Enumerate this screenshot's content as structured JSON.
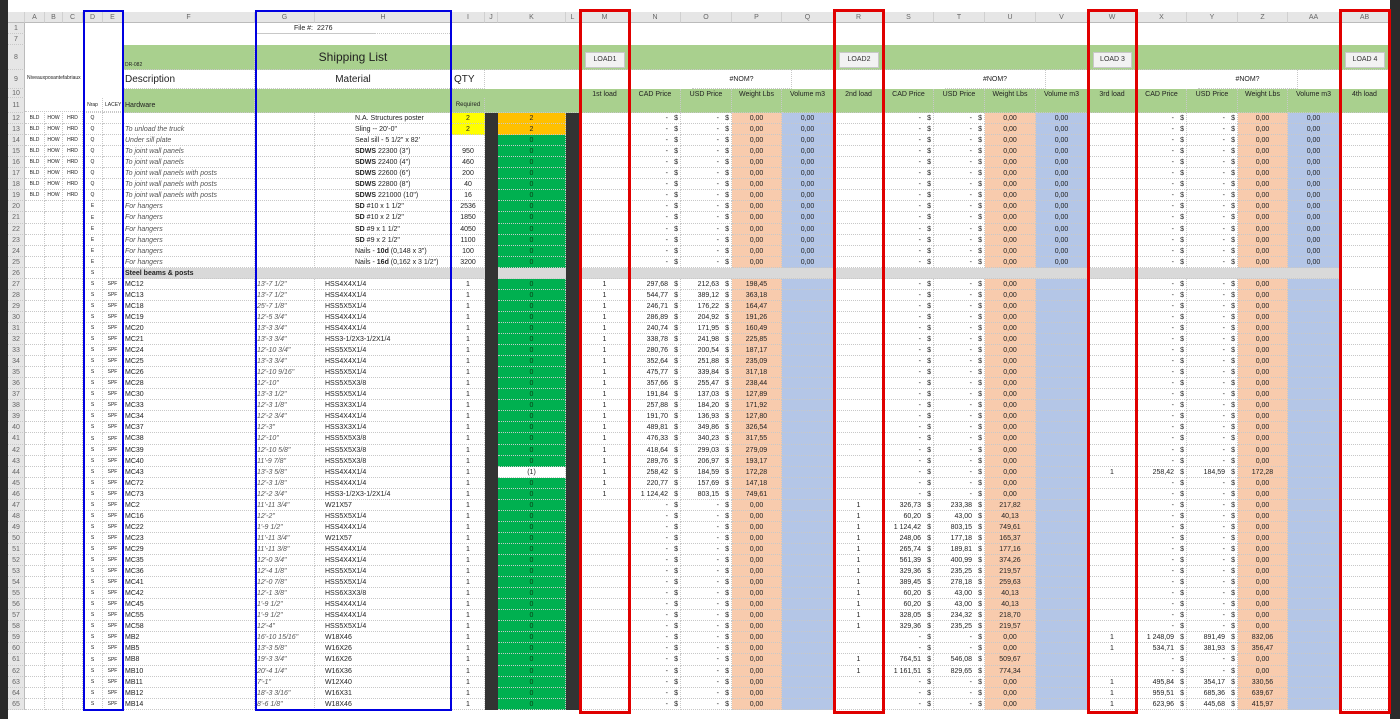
{
  "column_letters": [
    "A",
    "B",
    "C",
    "D",
    "E",
    "F",
    "G",
    "H",
    "I",
    "J",
    "K",
    "L",
    "M",
    "N",
    "O",
    "P",
    "Q",
    "R",
    "S",
    "T",
    "U",
    "V",
    "W",
    "X",
    "Y",
    "Z",
    "AA",
    "AB"
  ],
  "header": {
    "file_label": "File #:",
    "file_number": "2276",
    "doc_code": "DR-082",
    "title": "Shipping List",
    "description_label": "Description",
    "material_label": "Material",
    "qty_label": "QTY",
    "section_label": "Hardware",
    "required_label": "Required",
    "side_label": "Niveauxposantefabriaux",
    "d_label": "Nrap",
    "e_label": "LACEY",
    "error_value": "#NOM?",
    "loads": [
      {
        "button": "LOAD1",
        "qty_label": "1st load"
      },
      {
        "button": "LOAD2",
        "qty_label": "2nd load"
      },
      {
        "button": "LOAD 3",
        "qty_label": "3rd load"
      },
      {
        "button": "LOAD 4",
        "qty_label": "4th load"
      }
    ],
    "cad_label": "CAD Price",
    "usd_label": "USD Price",
    "weight_label": "Weight Lbs",
    "volume_label": "Volume m3"
  },
  "currency": "$",
  "empty_load": [
    "",
    "-",
    "-",
    "0,00"
  ],
  "colors": {
    "header_green": "#a9d08e",
    "required_green": "#00b050",
    "qty_orange": "#ffc000",
    "qty_yellow": "#ffff00",
    "weight": "#f8cbad",
    "volume": "#b4c6e7",
    "highlight_red": "#e00000",
    "highlight_blue": "#0000e0"
  },
  "rows": [
    {
      "r": "12",
      "A": "BLD",
      "B": "HOW",
      "C": "HRD",
      "D": "Q",
      "F": "",
      "H": [
        "",
        "",
        "N.A. Structures poster"
      ],
      "I": "2",
      "Ic": "yellow",
      "K": "2",
      "Kc": "orange",
      "vol": "0,00"
    },
    {
      "r": "13",
      "A": "BLD",
      "B": "HOW",
      "C": "HRD",
      "D": "Q",
      "F": "To unload the truck",
      "H": [
        "",
        "",
        "Sling -- 20'-0\""
      ],
      "I": "2",
      "Ic": "yellow",
      "K": "2",
      "Kc": "orange",
      "vol": "0,00"
    },
    {
      "r": "14",
      "A": "BLD",
      "B": "HOW",
      "C": "HRD",
      "D": "Q",
      "F": "Under sill plate",
      "H": [
        "",
        "",
        "Seal sill - 5 1/2\" x 82'"
      ],
      "I": "",
      "K": "0",
      "vol": "0,00"
    },
    {
      "r": "15",
      "A": "BLD",
      "B": "HOW",
      "C": "HRD",
      "D": "Q",
      "F": "To joint wall panels",
      "H": [
        "",
        "SDWS",
        " 22300 (3\")"
      ],
      "I": "950",
      "K": "0",
      "vol": "0,00"
    },
    {
      "r": "16",
      "A": "BLD",
      "B": "HOW",
      "C": "HRD",
      "D": "Q",
      "F": "To joint wall panels",
      "H": [
        "",
        "SDWS",
        " 22400 (4\")"
      ],
      "I": "460",
      "K": "0",
      "vol": "0,00"
    },
    {
      "r": "17",
      "A": "BLD",
      "B": "HOW",
      "C": "HRD",
      "D": "Q",
      "F": "To joint wall panels with posts",
      "H": [
        "",
        "SDWS",
        " 22600 (6\")"
      ],
      "I": "200",
      "K": "0",
      "vol": "0,00"
    },
    {
      "r": "18",
      "A": "BLD",
      "B": "HOW",
      "C": "HRD",
      "D": "Q",
      "F": "To joint wall panels with posts",
      "H": [
        "",
        "SDWS",
        " 22800 (8\")"
      ],
      "I": "40",
      "K": "0",
      "vol": "0,00"
    },
    {
      "r": "19",
      "A": "BLD",
      "B": "HOW",
      "C": "HRD",
      "D": "Q",
      "F": "To joint wall panels with posts",
      "H": [
        "",
        "SDWS",
        " 221000 (10\")"
      ],
      "I": "16",
      "K": "0",
      "vol": "0,00"
    },
    {
      "r": "20",
      "D": "E",
      "F": "For hangers",
      "H": [
        "",
        "SD",
        " #10 x 1 1/2\""
      ],
      "I": "2536",
      "K": "0",
      "vol": "0,00"
    },
    {
      "r": "21",
      "D": "E",
      "F": "For hangers",
      "H": [
        "",
        "SD",
        " #10 x 2 1/2\""
      ],
      "I": "1850",
      "K": "0",
      "vol": "0,00"
    },
    {
      "r": "22",
      "D": "E",
      "F": "For hangers",
      "H": [
        "",
        "SD",
        " #9 x 1 1/2\""
      ],
      "I": "4050",
      "K": "0",
      "vol": "0,00"
    },
    {
      "r": "23",
      "D": "E",
      "F": "For hangers",
      "H": [
        "",
        "SD",
        " #9 x 2 1/2\""
      ],
      "I": "1100",
      "K": "0",
      "vol": "0,00"
    },
    {
      "r": "24",
      "D": "E",
      "F": "For hangers",
      "H": [
        "Nails - ",
        "10d",
        " (0,148 x 3\")"
      ],
      "I": "100",
      "K": "0",
      "vol": "0,00"
    },
    {
      "r": "25",
      "D": "E",
      "F": "For hangers",
      "H": [
        "Nails - ",
        "16d",
        " (0,162 x 3 1/2\")"
      ],
      "I": "3200",
      "K": "0",
      "vol": "0,00"
    },
    {
      "r": "26",
      "D": "S",
      "F": "Steel beams & posts",
      "section": true
    },
    {
      "r": "27",
      "D": "S",
      "E": "SPF",
      "F": "MC12",
      "G": "13'-7 1/2\"",
      "H": [
        "",
        "",
        "HSS4X4X1/4"
      ],
      "I": "1",
      "K": "0",
      "loads": [
        [
          "1",
          "297,68",
          "212,63",
          "198,45"
        ],
        null,
        null
      ]
    },
    {
      "r": "28",
      "D": "S",
      "E": "SPF",
      "F": "MC13",
      "G": "13'-7 1/2\"",
      "H": [
        "",
        "",
        "HSS4X4X1/4"
      ],
      "I": "1",
      "K": "0",
      "loads": [
        [
          "1",
          "544,77",
          "389,12",
          "363,18"
        ],
        null,
        null
      ]
    },
    {
      "r": "29",
      "D": "S",
      "E": "SPF",
      "F": "MC18",
      "G": "25'-7 1/8\"",
      "H": [
        "",
        "",
        "HSS5X5X1/4"
      ],
      "I": "1",
      "K": "0",
      "loads": [
        [
          "1",
          "246,71",
          "176,22",
          "164,47"
        ],
        null,
        null
      ]
    },
    {
      "r": "30",
      "D": "S",
      "E": "SPF",
      "F": "MC19",
      "G": "12'-5 3/4\"",
      "H": [
        "",
        "",
        "HSS4X4X1/4"
      ],
      "I": "1",
      "K": "0",
      "loads": [
        [
          "1",
          "286,89",
          "204,92",
          "191,26"
        ],
        null,
        null
      ]
    },
    {
      "r": "31",
      "D": "S",
      "E": "SPF",
      "F": "MC20",
      "G": "13'-3 3/4\"",
      "H": [
        "",
        "",
        "HSS4X4X1/4"
      ],
      "I": "1",
      "K": "0",
      "loads": [
        [
          "1",
          "240,74",
          "171,95",
          "160,49"
        ],
        null,
        null
      ]
    },
    {
      "r": "32",
      "D": "S",
      "E": "SPF",
      "F": "MC21",
      "G": "13'-3 3/4\"",
      "H": [
        "",
        "",
        "HSS3-1/2X3-1/2X1/4"
      ],
      "I": "1",
      "K": "0",
      "loads": [
        [
          "1",
          "338,78",
          "241,98",
          "225,85"
        ],
        null,
        null
      ]
    },
    {
      "r": "33",
      "D": "S",
      "E": "SPF",
      "F": "MC24",
      "G": "12'-10 3/4\"",
      "H": [
        "",
        "",
        "HSS5X5X1/4"
      ],
      "I": "1",
      "K": "0",
      "loads": [
        [
          "1",
          "280,76",
          "200,54",
          "187,17"
        ],
        null,
        null
      ]
    },
    {
      "r": "34",
      "D": "S",
      "E": "SPF",
      "F": "MC25",
      "G": "13'-3 3/4\"",
      "H": [
        "",
        "",
        "HSS4X4X1/4"
      ],
      "I": "1",
      "K": "0",
      "loads": [
        [
          "1",
          "352,64",
          "251,88",
          "235,09"
        ],
        null,
        null
      ]
    },
    {
      "r": "35",
      "D": "S",
      "E": "SPF",
      "F": "MC26",
      "G": "12'-10 9/16\"",
      "H": [
        "",
        "",
        "HSS5X5X1/4"
      ],
      "I": "1",
      "K": "0",
      "loads": [
        [
          "1",
          "475,77",
          "339,84",
          "317,18"
        ],
        null,
        null
      ]
    },
    {
      "r": "36",
      "D": "S",
      "E": "SPF",
      "F": "MC28",
      "G": "12'-10\"",
      "H": [
        "",
        "",
        "HSS5X5X3/8"
      ],
      "I": "1",
      "K": "0",
      "loads": [
        [
          "1",
          "357,66",
          "255,47",
          "238,44"
        ],
        null,
        null
      ]
    },
    {
      "r": "37",
      "D": "S",
      "E": "SPF",
      "F": "MC30",
      "G": "13'-3 1/2\"",
      "H": [
        "",
        "",
        "HSS5X5X1/4"
      ],
      "I": "1",
      "K": "0",
      "loads": [
        [
          "1",
          "191,84",
          "137,03",
          "127,89"
        ],
        null,
        null
      ]
    },
    {
      "r": "38",
      "D": "S",
      "E": "SPF",
      "F": "MC33",
      "G": "12'-3 1/8\"",
      "H": [
        "",
        "",
        "HSS3X3X1/4"
      ],
      "I": "1",
      "K": "0",
      "loads": [
        [
          "1",
          "257,88",
          "184,20",
          "171,92"
        ],
        null,
        null
      ]
    },
    {
      "r": "39",
      "D": "S",
      "E": "SPF",
      "F": "MC34",
      "G": "12'-2 3/4\"",
      "H": [
        "",
        "",
        "HSS4X4X1/4"
      ],
      "I": "1",
      "K": "0",
      "loads": [
        [
          "1",
          "191,70",
          "136,93",
          "127,80"
        ],
        null,
        null
      ]
    },
    {
      "r": "40",
      "D": "S",
      "E": "SPF",
      "F": "MC37",
      "G": "12'-3\"",
      "H": [
        "",
        "",
        "HSS3X3X1/4"
      ],
      "I": "1",
      "K": "0",
      "loads": [
        [
          "1",
          "489,81",
          "349,86",
          "326,54"
        ],
        null,
        null
      ]
    },
    {
      "r": "41",
      "D": "S",
      "E": "SPF",
      "F": "MC38",
      "G": "12'-10\"",
      "H": [
        "",
        "",
        "HSS5X5X3/8"
      ],
      "I": "1",
      "K": "0",
      "loads": [
        [
          "1",
          "476,33",
          "340,23",
          "317,55"
        ],
        null,
        null
      ]
    },
    {
      "r": "42",
      "D": "S",
      "E": "SPF",
      "F": "MC39",
      "G": "12'-10 5/8\"",
      "H": [
        "",
        "",
        "HSS5X5X3/8"
      ],
      "I": "1",
      "K": "0",
      "loads": [
        [
          "1",
          "418,64",
          "299,03",
          "279,09"
        ],
        null,
        null
      ]
    },
    {
      "r": "43",
      "D": "S",
      "E": "SPF",
      "F": "MC40",
      "G": "11'-9 7/8\"",
      "H": [
        "",
        "",
        "HSS5X5X3/8"
      ],
      "I": "1",
      "K": "0",
      "loads": [
        [
          "1",
          "289,76",
          "206,97",
          "193,17"
        ],
        null,
        null
      ]
    },
    {
      "r": "44",
      "D": "S",
      "E": "SPF",
      "F": "MC43",
      "G": "13'-3 5/8\"",
      "H": [
        "",
        "",
        "HSS4X4X1/4"
      ],
      "I": "1",
      "K": "(1)",
      "Kc": "white",
      "loads": [
        [
          "1",
          "258,42",
          "184,59",
          "172,28"
        ],
        null,
        [
          "1",
          "258,42",
          "184,59",
          "172,28"
        ]
      ]
    },
    {
      "r": "45",
      "D": "S",
      "E": "SPF",
      "F": "MC72",
      "G": "12'-3 1/8\"",
      "H": [
        "",
        "",
        "HSS4X4X1/4"
      ],
      "I": "1",
      "K": "0",
      "loads": [
        [
          "1",
          "220,77",
          "157,69",
          "147,18"
        ],
        null,
        null
      ]
    },
    {
      "r": "46",
      "D": "S",
      "E": "SPF",
      "F": "MC73",
      "G": "12'-2 3/4\"",
      "H": [
        "",
        "",
        "HSS3-1/2X3-1/2X1/4"
      ],
      "I": "1",
      "K": "0",
      "loads": [
        [
          "1",
          "1 124,42",
          "803,15",
          "749,61"
        ],
        null,
        null
      ]
    },
    {
      "r": "47",
      "D": "S",
      "E": "SPF",
      "F": "MC2",
      "G": "11'-11 3/4\"",
      "H": [
        "",
        "",
        "W21X57"
      ],
      "I": "1",
      "K": "0",
      "loads": [
        null,
        [
          "1",
          "326,73",
          "233,38",
          "217,82"
        ],
        null
      ]
    },
    {
      "r": "48",
      "D": "S",
      "E": "SPF",
      "F": "MC16",
      "G": "12'-2\"",
      "H": [
        "",
        "",
        "HSS5X5X1/4"
      ],
      "I": "1",
      "K": "0",
      "loads": [
        null,
        [
          "1",
          "60,20",
          "43,00",
          "40,13"
        ],
        null
      ]
    },
    {
      "r": "49",
      "D": "S",
      "E": "SPF",
      "F": "MC22",
      "G": "1'-9 1/2\"",
      "H": [
        "",
        "",
        "HSS4X4X1/4"
      ],
      "I": "1",
      "K": "0",
      "loads": [
        null,
        [
          "1",
          "1 124,42",
          "803,15",
          "749,61"
        ],
        null
      ]
    },
    {
      "r": "50",
      "D": "S",
      "E": "SPF",
      "F": "MC23",
      "G": "11'-11 3/4\"",
      "H": [
        "",
        "",
        "W21X57"
      ],
      "I": "1",
      "K": "0",
      "loads": [
        null,
        [
          "1",
          "248,06",
          "177,18",
          "165,37"
        ],
        null
      ]
    },
    {
      "r": "51",
      "D": "S",
      "E": "SPF",
      "F": "MC29",
      "G": "11'-11 3/8\"",
      "H": [
        "",
        "",
        "HSS4X4X1/4"
      ],
      "I": "1",
      "K": "0",
      "loads": [
        null,
        [
          "1",
          "265,74",
          "189,81",
          "177,16"
        ],
        null
      ]
    },
    {
      "r": "52",
      "D": "S",
      "E": "SPF",
      "F": "MC35",
      "G": "12'-0 3/4\"",
      "H": [
        "",
        "",
        "HSS4X4X1/4"
      ],
      "I": "1",
      "K": "0",
      "loads": [
        null,
        [
          "1",
          "561,39",
          "400,99",
          "374,26"
        ],
        null
      ]
    },
    {
      "r": "53",
      "D": "S",
      "E": "SPF",
      "F": "MC36",
      "G": "12'-4 1/8\"",
      "H": [
        "",
        "",
        "HSS5X5X1/4"
      ],
      "I": "1",
      "K": "0",
      "loads": [
        null,
        [
          "1",
          "329,36",
          "235,25",
          "219,57"
        ],
        null
      ]
    },
    {
      "r": "54",
      "D": "S",
      "E": "SPF",
      "F": "MC41",
      "G": "12'-0 7/8\"",
      "H": [
        "",
        "",
        "HSS5X5X1/4"
      ],
      "I": "1",
      "K": "0",
      "loads": [
        null,
        [
          "1",
          "389,45",
          "278,18",
          "259,63"
        ],
        null
      ]
    },
    {
      "r": "55",
      "D": "S",
      "E": "SPF",
      "F": "MC42",
      "G": "12'-1 3/8\"",
      "H": [
        "",
        "",
        "HSS6X3X3/8"
      ],
      "I": "1",
      "K": "0",
      "loads": [
        null,
        [
          "1",
          "60,20",
          "43,00",
          "40,13"
        ],
        null
      ]
    },
    {
      "r": "56",
      "D": "S",
      "E": "SPF",
      "F": "MC45",
      "G": "1'-9 1/2\"",
      "H": [
        "",
        "",
        "HSS4X4X1/4"
      ],
      "I": "1",
      "K": "0",
      "loads": [
        null,
        [
          "1",
          "60,20",
          "43,00",
          "40,13"
        ],
        null
      ]
    },
    {
      "r": "57",
      "D": "S",
      "E": "SPF",
      "F": "MC55",
      "G": "1'-9 1/2\"",
      "H": [
        "",
        "",
        "HSS4X4X1/4"
      ],
      "I": "1",
      "K": "0",
      "loads": [
        null,
        [
          "1",
          "328,05",
          "234,32",
          "218,70"
        ],
        null
      ]
    },
    {
      "r": "58",
      "D": "S",
      "E": "SPF",
      "F": "MC58",
      "G": "12'-4\"",
      "H": [
        "",
        "",
        "HSS5X5X1/4"
      ],
      "I": "1",
      "K": "0",
      "loads": [
        null,
        [
          "1",
          "329,36",
          "235,25",
          "219,57"
        ],
        null
      ]
    },
    {
      "r": "59",
      "D": "S",
      "E": "SPF",
      "F": "MB2",
      "G": "16'-10 15/16\"",
      "H": [
        "",
        "",
        "W18X46"
      ],
      "I": "1",
      "K": "0",
      "loads": [
        null,
        null,
        [
          "1",
          "1 248,09",
          "891,49",
          "832,06"
        ]
      ]
    },
    {
      "r": "60",
      "D": "S",
      "E": "SPF",
      "F": "MB5",
      "G": "13'-3 5/8\"",
      "H": [
        "",
        "",
        "W16X26"
      ],
      "I": "1",
      "K": "0",
      "loads": [
        null,
        null,
        [
          "1",
          "534,71",
          "381,93",
          "356,47"
        ]
      ]
    },
    {
      "r": "61",
      "D": "S",
      "E": "SPF",
      "F": "MB8",
      "G": "19'-3 3/4\"",
      "H": [
        "",
        "",
        "W16X26"
      ],
      "I": "1",
      "K": "0",
      "loads": [
        null,
        [
          "1",
          "764,51",
          "546,08",
          "509,67"
        ],
        null
      ]
    },
    {
      "r": "62",
      "D": "S",
      "E": "SPF",
      "F": "MB10",
      "G": "20'-4 1/4\"",
      "H": [
        "",
        "",
        "W16X36"
      ],
      "I": "1",
      "K": "0",
      "loads": [
        null,
        [
          "1",
          "1 161,51",
          "829,65",
          "774,34"
        ],
        null
      ]
    },
    {
      "r": "63",
      "D": "S",
      "E": "SPF",
      "F": "MB11",
      "G": "7'-1\"",
      "H": [
        "",
        "",
        "W12X40"
      ],
      "I": "1",
      "K": "0",
      "loads": [
        null,
        null,
        [
          "1",
          "495,84",
          "354,17",
          "330,56"
        ]
      ]
    },
    {
      "r": "64",
      "D": "S",
      "E": "SPF",
      "F": "MB12",
      "G": "18'-3 3/16\"",
      "H": [
        "",
        "",
        "W16X31"
      ],
      "I": "1",
      "K": "0",
      "loads": [
        null,
        null,
        [
          "1",
          "959,51",
          "685,36",
          "639,67"
        ]
      ]
    },
    {
      "r": "65",
      "D": "S",
      "E": "SPF",
      "F": "MB14",
      "G": "8'-6 1/8\"",
      "H": [
        "",
        "",
        "W18X46"
      ],
      "I": "1",
      "K": "0",
      "loads": [
        null,
        null,
        [
          "1",
          "623,96",
          "445,68",
          "415,97"
        ]
      ]
    }
  ]
}
